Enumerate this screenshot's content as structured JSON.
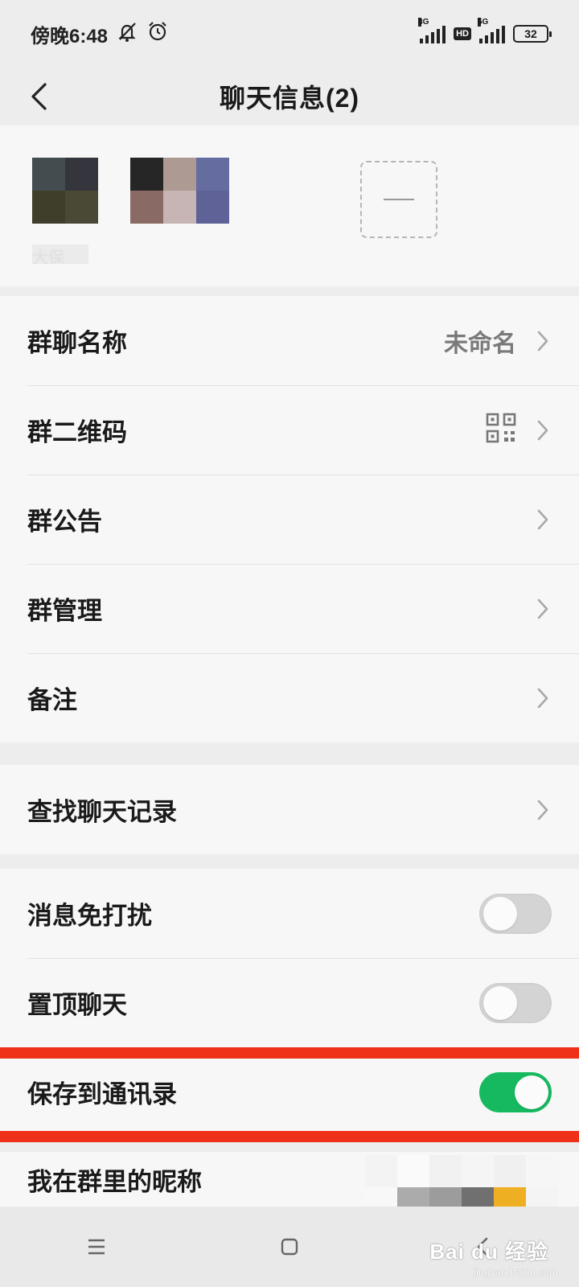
{
  "status_bar": {
    "time": "傍晚6:48",
    "sim1_network": "3G",
    "hd_badge": "HD",
    "sim2_network": "5G",
    "battery_level": "32",
    "icons": [
      "mute-icon",
      "alarm-icon",
      "signal-icon",
      "battery-icon"
    ]
  },
  "header": {
    "title": "聊天信息(2)",
    "back_icon": "chevron-left-icon"
  },
  "members": {
    "member_name_blurred": "大保",
    "add_icon": "add-member-icon"
  },
  "settings": {
    "group1": [
      {
        "label": "群聊名称",
        "value": "未命名"
      },
      {
        "label": "群二维码",
        "value": ""
      },
      {
        "label": "群公告",
        "value": ""
      },
      {
        "label": "群管理",
        "value": ""
      },
      {
        "label": "备注",
        "value": ""
      }
    ],
    "group2": [
      {
        "label": "查找聊天记录"
      }
    ],
    "group3": [
      {
        "label": "消息免打扰",
        "toggle": false
      },
      {
        "label": "置顶聊天",
        "toggle": false
      },
      {
        "label": "保存到通讯录",
        "toggle": true
      }
    ],
    "group4": [
      {
        "label": "我在群里的昵称"
      }
    ]
  },
  "colors": {
    "toggle_on": "#16b95f",
    "toggle_off": "#d4d4d4",
    "highlight_annotation": "#f0311a",
    "background": "#ededed",
    "card": "#f7f7f7"
  },
  "system_nav": {
    "menu_icon": "menu-icon",
    "home_icon": "home-square-icon",
    "back_icon": "back-triangle-icon"
  },
  "watermark": {
    "text": "Bai du 经验",
    "sub": "jingyan.baidu.com"
  }
}
